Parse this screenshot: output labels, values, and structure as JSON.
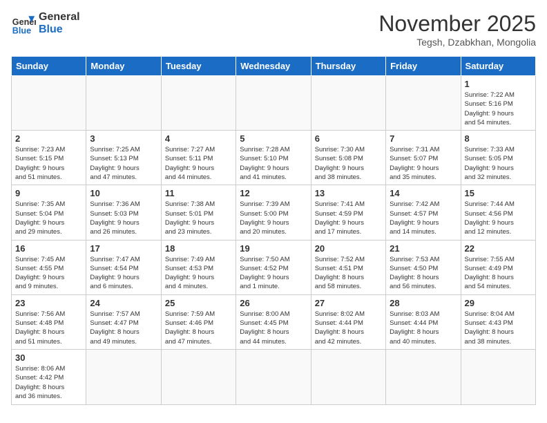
{
  "logo": {
    "text_general": "General",
    "text_blue": "Blue"
  },
  "header": {
    "title": "November 2025",
    "subtitle": "Tegsh, Dzabkhan, Mongolia"
  },
  "weekdays": [
    "Sunday",
    "Monday",
    "Tuesday",
    "Wednesday",
    "Thursday",
    "Friday",
    "Saturday"
  ],
  "days": {
    "d1": {
      "num": "1",
      "info": "Sunrise: 7:22 AM\nSunset: 5:16 PM\nDaylight: 9 hours\nand 54 minutes."
    },
    "d2": {
      "num": "2",
      "info": "Sunrise: 7:23 AM\nSunset: 5:15 PM\nDaylight: 9 hours\nand 51 minutes."
    },
    "d3": {
      "num": "3",
      "info": "Sunrise: 7:25 AM\nSunset: 5:13 PM\nDaylight: 9 hours\nand 47 minutes."
    },
    "d4": {
      "num": "4",
      "info": "Sunrise: 7:27 AM\nSunset: 5:11 PM\nDaylight: 9 hours\nand 44 minutes."
    },
    "d5": {
      "num": "5",
      "info": "Sunrise: 7:28 AM\nSunset: 5:10 PM\nDaylight: 9 hours\nand 41 minutes."
    },
    "d6": {
      "num": "6",
      "info": "Sunrise: 7:30 AM\nSunset: 5:08 PM\nDaylight: 9 hours\nand 38 minutes."
    },
    "d7": {
      "num": "7",
      "info": "Sunrise: 7:31 AM\nSunset: 5:07 PM\nDaylight: 9 hours\nand 35 minutes."
    },
    "d8": {
      "num": "8",
      "info": "Sunrise: 7:33 AM\nSunset: 5:05 PM\nDaylight: 9 hours\nand 32 minutes."
    },
    "d9": {
      "num": "9",
      "info": "Sunrise: 7:35 AM\nSunset: 5:04 PM\nDaylight: 9 hours\nand 29 minutes."
    },
    "d10": {
      "num": "10",
      "info": "Sunrise: 7:36 AM\nSunset: 5:03 PM\nDaylight: 9 hours\nand 26 minutes."
    },
    "d11": {
      "num": "11",
      "info": "Sunrise: 7:38 AM\nSunset: 5:01 PM\nDaylight: 9 hours\nand 23 minutes."
    },
    "d12": {
      "num": "12",
      "info": "Sunrise: 7:39 AM\nSunset: 5:00 PM\nDaylight: 9 hours\nand 20 minutes."
    },
    "d13": {
      "num": "13",
      "info": "Sunrise: 7:41 AM\nSunset: 4:59 PM\nDaylight: 9 hours\nand 17 minutes."
    },
    "d14": {
      "num": "14",
      "info": "Sunrise: 7:42 AM\nSunset: 4:57 PM\nDaylight: 9 hours\nand 14 minutes."
    },
    "d15": {
      "num": "15",
      "info": "Sunrise: 7:44 AM\nSunset: 4:56 PM\nDaylight: 9 hours\nand 12 minutes."
    },
    "d16": {
      "num": "16",
      "info": "Sunrise: 7:45 AM\nSunset: 4:55 PM\nDaylight: 9 hours\nand 9 minutes."
    },
    "d17": {
      "num": "17",
      "info": "Sunrise: 7:47 AM\nSunset: 4:54 PM\nDaylight: 9 hours\nand 6 minutes."
    },
    "d18": {
      "num": "18",
      "info": "Sunrise: 7:49 AM\nSunset: 4:53 PM\nDaylight: 9 hours\nand 4 minutes."
    },
    "d19": {
      "num": "19",
      "info": "Sunrise: 7:50 AM\nSunset: 4:52 PM\nDaylight: 9 hours\nand 1 minute."
    },
    "d20": {
      "num": "20",
      "info": "Sunrise: 7:52 AM\nSunset: 4:51 PM\nDaylight: 8 hours\nand 58 minutes."
    },
    "d21": {
      "num": "21",
      "info": "Sunrise: 7:53 AM\nSunset: 4:50 PM\nDaylight: 8 hours\nand 56 minutes."
    },
    "d22": {
      "num": "22",
      "info": "Sunrise: 7:55 AM\nSunset: 4:49 PM\nDaylight: 8 hours\nand 54 minutes."
    },
    "d23": {
      "num": "23",
      "info": "Sunrise: 7:56 AM\nSunset: 4:48 PM\nDaylight: 8 hours\nand 51 minutes."
    },
    "d24": {
      "num": "24",
      "info": "Sunrise: 7:57 AM\nSunset: 4:47 PM\nDaylight: 8 hours\nand 49 minutes."
    },
    "d25": {
      "num": "25",
      "info": "Sunrise: 7:59 AM\nSunset: 4:46 PM\nDaylight: 8 hours\nand 47 minutes."
    },
    "d26": {
      "num": "26",
      "info": "Sunrise: 8:00 AM\nSunset: 4:45 PM\nDaylight: 8 hours\nand 44 minutes."
    },
    "d27": {
      "num": "27",
      "info": "Sunrise: 8:02 AM\nSunset: 4:44 PM\nDaylight: 8 hours\nand 42 minutes."
    },
    "d28": {
      "num": "28",
      "info": "Sunrise: 8:03 AM\nSunset: 4:44 PM\nDaylight: 8 hours\nand 40 minutes."
    },
    "d29": {
      "num": "29",
      "info": "Sunrise: 8:04 AM\nSunset: 4:43 PM\nDaylight: 8 hours\nand 38 minutes."
    },
    "d30": {
      "num": "30",
      "info": "Sunrise: 8:06 AM\nSunset: 4:42 PM\nDaylight: 8 hours\nand 36 minutes."
    }
  }
}
